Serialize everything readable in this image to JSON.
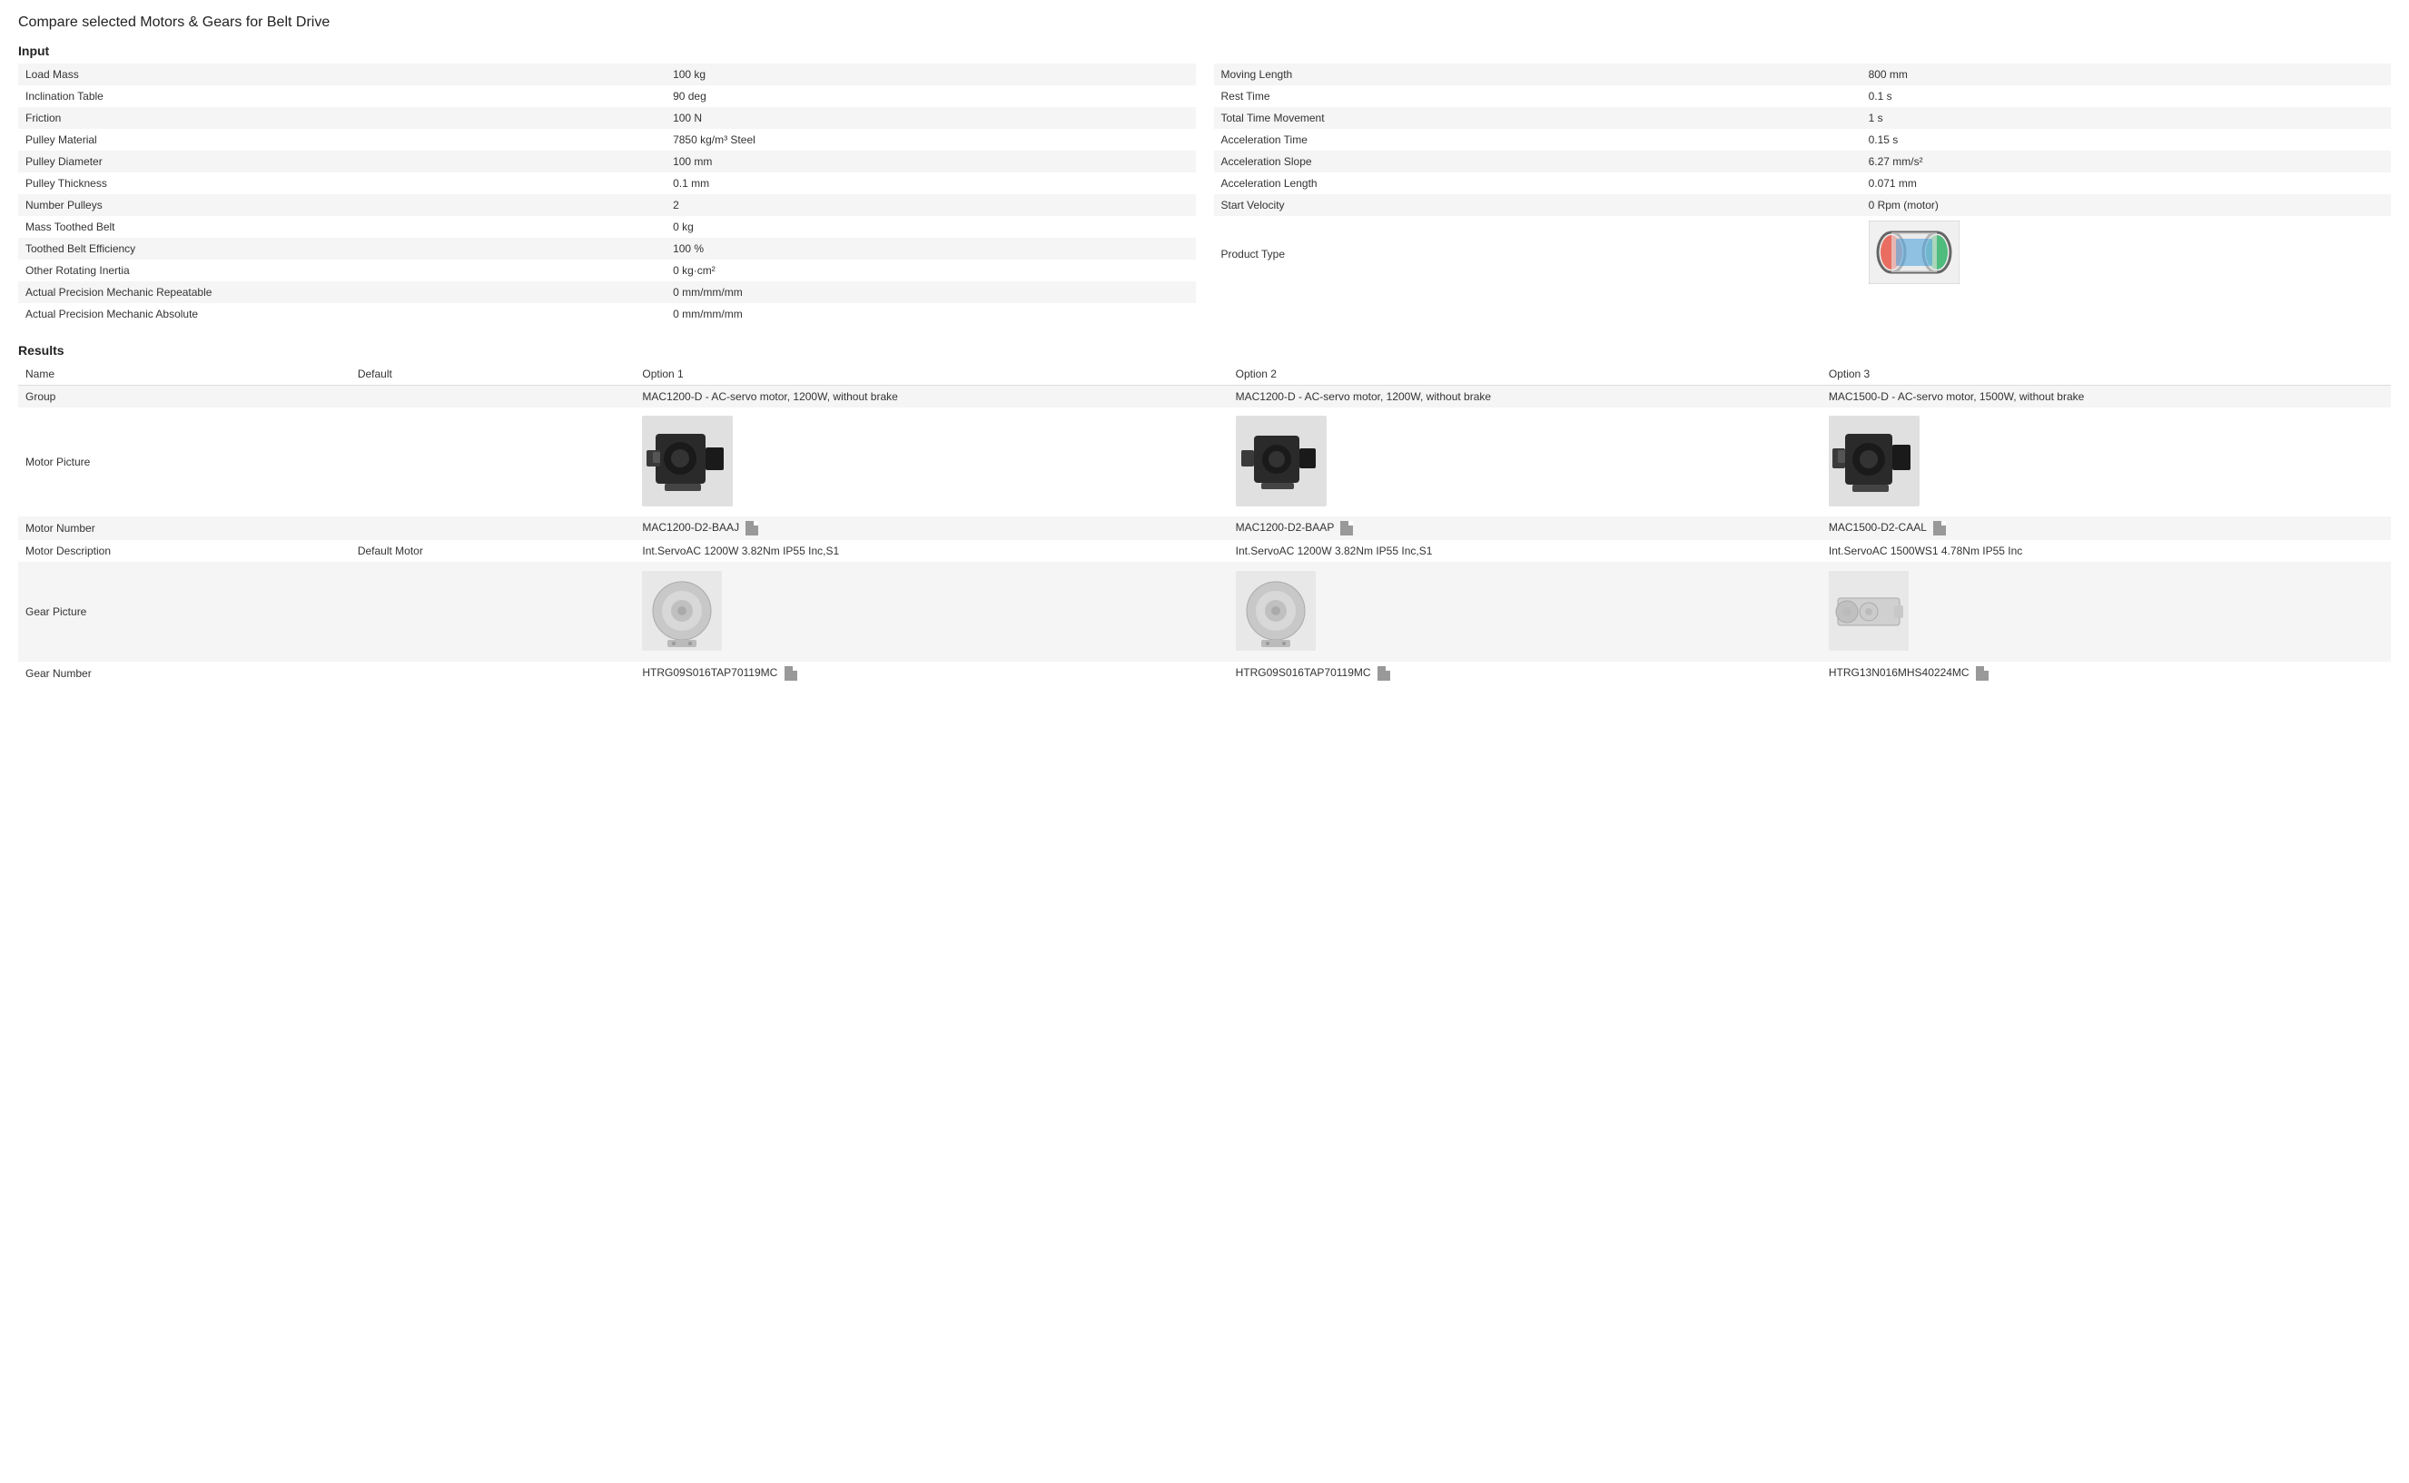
{
  "page": {
    "title": "Compare selected Motors & Gears for Belt Drive"
  },
  "input_section": {
    "label": "Input",
    "left_table": [
      {
        "label": "Load Mass",
        "value": "100 kg"
      },
      {
        "label": "Inclination Table",
        "value": "90 deg"
      },
      {
        "label": "Friction",
        "value": "100 N"
      },
      {
        "label": "Pulley Material",
        "value": "7850 kg/m³ Steel"
      },
      {
        "label": "Pulley Diameter",
        "value": "100 mm"
      },
      {
        "label": "Pulley Thickness",
        "value": "0.1 mm"
      },
      {
        "label": "Number Pulleys",
        "value": "2"
      },
      {
        "label": "Mass Toothed Belt",
        "value": "0 kg"
      },
      {
        "label": "Toothed Belt Efficiency",
        "value": "100 %"
      },
      {
        "label": "Other Rotating Inertia",
        "value": "0 kg·cm²"
      },
      {
        "label": "Actual Precision Mechanic Repeatable",
        "value": "0 mm/mm/mm"
      },
      {
        "label": "Actual Precision Mechanic Absolute",
        "value": "0 mm/mm/mm"
      }
    ],
    "right_table": [
      {
        "label": "Moving Length",
        "value": "800 mm"
      },
      {
        "label": "Rest Time",
        "value": "0.1 s"
      },
      {
        "label": "Total Time Movement",
        "value": "1 s"
      },
      {
        "label": "Acceleration Time",
        "value": "0.15 s"
      },
      {
        "label": "Acceleration Slope",
        "value": "6.27 mm/s²"
      },
      {
        "label": "Acceleration Length",
        "value": "0.071 mm"
      },
      {
        "label": "Start Velocity",
        "value": "0 Rpm (motor)"
      },
      {
        "label": "Product Type",
        "value": ""
      }
    ]
  },
  "results_section": {
    "label": "Results",
    "columns": {
      "name": "Name",
      "default": "Default",
      "opt1": "Option 1",
      "opt2": "Option 2",
      "opt3": "Option 3"
    },
    "rows": {
      "group": {
        "label": "Group",
        "default": "",
        "opt1": "MAC1200-D - AC-servo motor, 1200W, without brake",
        "opt2": "MAC1200-D - AC-servo motor, 1200W, without brake",
        "opt3": "MAC1500-D - AC-servo motor, 1500W, without brake"
      },
      "motor_picture": {
        "label": "Motor Picture"
      },
      "motor_number": {
        "label": "Motor Number",
        "default": "",
        "opt1": "MAC1200-D2-BAAJ",
        "opt2": "MAC1200-D2-BAAP",
        "opt3": "MAC1500-D2-CAAL"
      },
      "motor_description": {
        "label": "Motor Description",
        "default": "Default Motor",
        "opt1": "Int.ServoAC 1200W 3.82Nm IP55 Inc,S1",
        "opt2": "Int.ServoAC 1200W 3.82Nm IP55 Inc,S1",
        "opt3": "Int.ServoAC 1500WS1 4.78Nm IP55 Inc"
      },
      "gear_picture": {
        "label": "Gear Picture"
      },
      "gear_number": {
        "label": "Gear Number",
        "default": "",
        "opt1": "HTRG09S016TAP70119MC",
        "opt2": "HTRG09S016TAP70119MC",
        "opt3": "HTRG13N016MHS40224MC"
      }
    }
  }
}
